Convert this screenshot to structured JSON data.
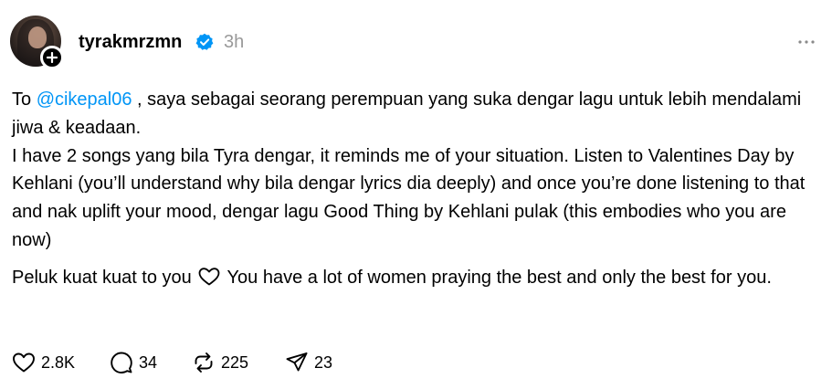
{
  "post": {
    "author": {
      "username": "tyrakmrzmn",
      "verified": true,
      "avatar_icon": "profile-photo",
      "follow_icon": "plus-icon"
    },
    "time_ago": "3h",
    "more_icon": "ellipsis-icon",
    "body": {
      "line1_prefix": "To ",
      "mention": "@cikepal06",
      "line1_rest": " , saya sebagai seorang perempuan yang suka dengar lagu untuk lebih mendalami jiwa & keadaan.",
      "line2": "I have 2 songs yang bila Tyra dengar, it reminds me of your situation. Listen to Valentines Day by Kehlani (you’ll understand why bila dengar lyrics dia deeply) and once you’re done listening to that and nak uplift your mood, dengar lagu Good Thing by Kehlani pulak (this embodies who you are now)",
      "para2_prefix": "Peluk kuat kuat to you",
      "para2_icon": "heart-icon",
      "para2_rest": " You have a lot of women praying the best and only the best for you."
    },
    "actions": {
      "likes": "2.8K",
      "replies": "34",
      "reposts": "225",
      "shares": "23"
    }
  },
  "colors": {
    "mention": "#0095f6",
    "muted": "#999999",
    "verified": "#0095f6"
  }
}
